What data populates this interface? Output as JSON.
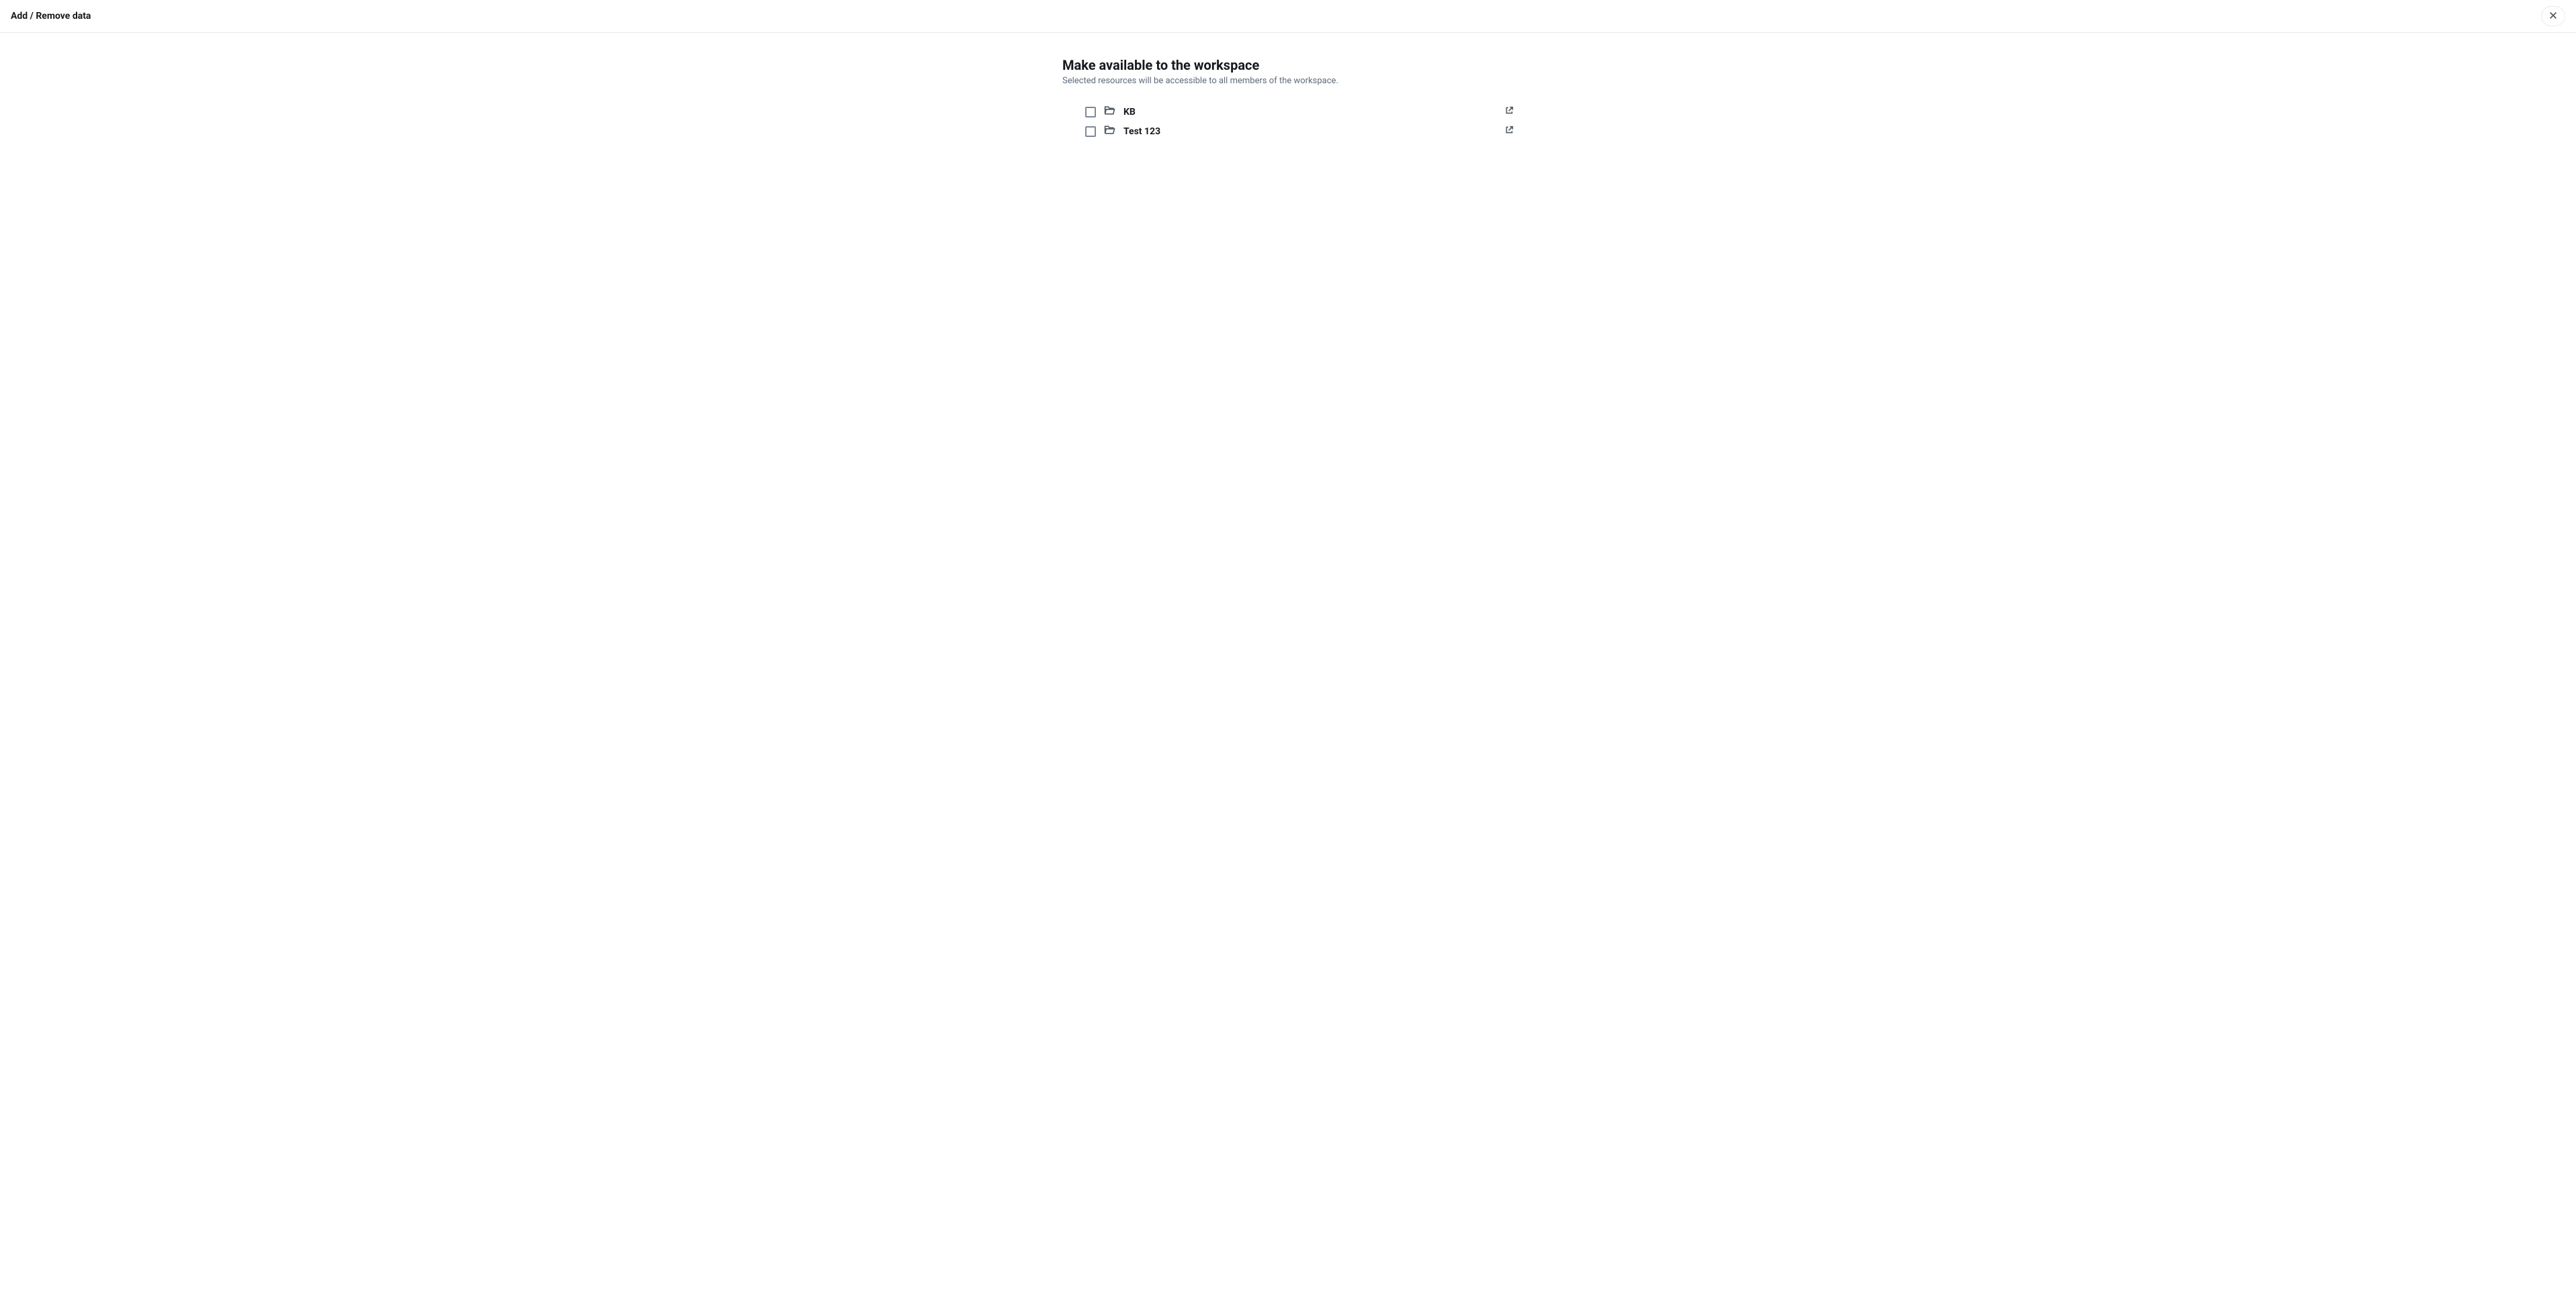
{
  "header": {
    "title": "Add / Remove data"
  },
  "main": {
    "title": "Make available to the workspace",
    "subtitle": "Selected resources will be accessible to all members of the workspace."
  },
  "resources": [
    {
      "label": "KB"
    },
    {
      "label": "Test 123"
    }
  ]
}
